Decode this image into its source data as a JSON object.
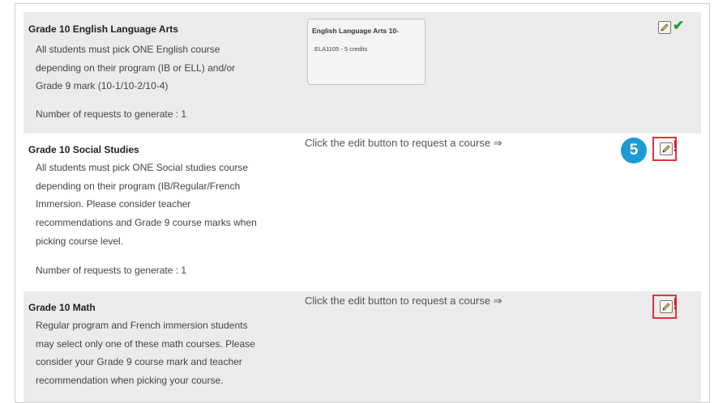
{
  "sections": [
    {
      "title": "Grade 10 English Language Arts",
      "description_lines": [
        "All students must pick ONE English course",
        "depending on their program (IB or ELL) and/or",
        "Grade 9 mark (10-1/10-2/10-4)"
      ],
      "requests_label": "Number of requests to generate : 1",
      "course": {
        "name": "English Language Arts 10-",
        "code": "ELA1105 - 5 credits"
      },
      "status_icons": [
        "edit-icon",
        "checkmark-icon"
      ]
    },
    {
      "title": "Grade 10 Social Studies",
      "description_lines": [
        "All students must pick ONE Social studies course",
        "depending on their program (IB/Regular/French",
        "Immersion. Please consider teacher",
        "recommendations and Grade 9 course marks when",
        "picking course level."
      ],
      "requests_label": "Number of requests to generate : 1",
      "instruction": "Click the edit button to request a course ⇒",
      "step_number": "5",
      "status_icons": [
        "edit-icon",
        "exclamation-icon"
      ]
    },
    {
      "title": "Grade 10 Math",
      "description_lines": [
        "Regular program and French immersion students",
        "may select only one of these math courses. Please",
        "consider your Grade 9 course mark and teacher",
        "recommendation when picking your course."
      ],
      "instruction": "Click the edit button to request a course ⇒",
      "status_icons": [
        "edit-icon",
        "exclamation-icon"
      ]
    }
  ],
  "colors": {
    "section_alt_bg": "#ebebeb",
    "check_green": "#2a9a2a",
    "alert_red": "#d11a1a",
    "highlight_red": "#e0353a",
    "step_badge_blue": "#1c9ad6"
  }
}
